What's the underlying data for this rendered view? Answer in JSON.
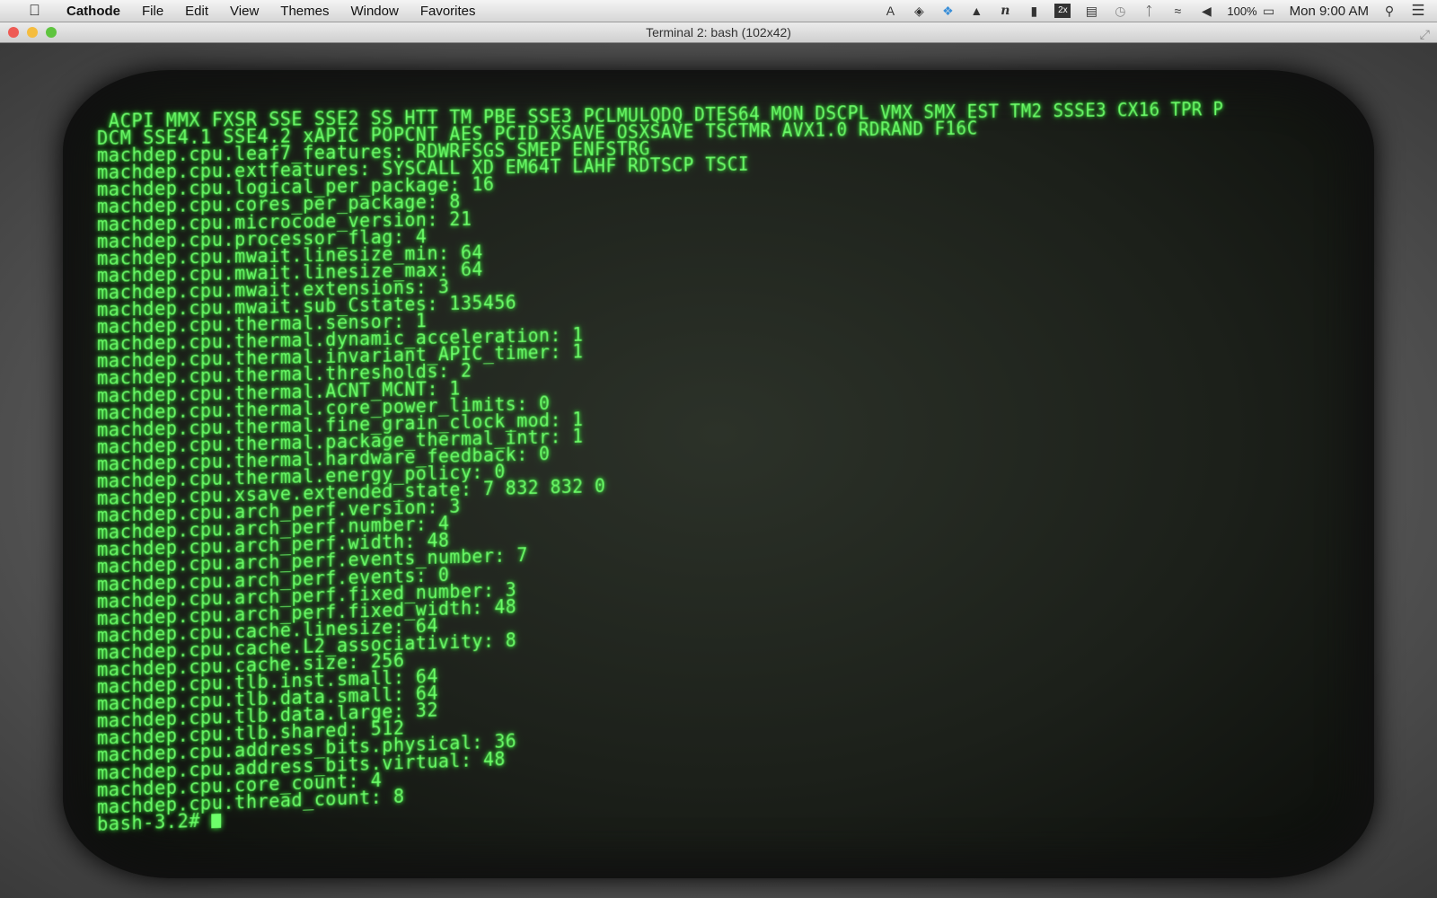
{
  "menubar": {
    "app": "Cathode",
    "items": [
      "File",
      "Edit",
      "View",
      "Themes",
      "Window",
      "Favorites"
    ],
    "status_icons": [
      "adobe-icon",
      "layers-icon",
      "dropbox-icon",
      "google-drive-icon",
      "n-icon",
      "istat-icon",
      "display-2x-icon",
      "memory-icon",
      "time-machine-icon",
      "bluetooth-icon",
      "wifi-icon",
      "volume-icon"
    ],
    "battery": "100%",
    "clock": "Mon 9:00 AM"
  },
  "window": {
    "title": "Terminal 2: bash (102x42)"
  },
  "terminal": {
    "lines": [
      " ACPI MMX FXSR SSE SSE2 SS HTT TM PBE SSE3 PCLMULQDQ DTES64 MON DSCPL VMX SMX EST TM2 SSSE3 CX16 TPR P",
      "DCM SSE4.1 SSE4.2 xAPIC POPCNT AES PCID XSAVE OSXSAVE TSCTMR AVX1.0 RDRAND F16C",
      "machdep.cpu.leaf7_features: RDWRFSGS SMEP ENFSTRG",
      "machdep.cpu.extfeatures: SYSCALL XD EM64T LAHF RDTSCP TSCI",
      "machdep.cpu.logical_per_package: 16",
      "machdep.cpu.cores_per_package: 8",
      "machdep.cpu.microcode_version: 21",
      "machdep.cpu.processor_flag: 4",
      "machdep.cpu.mwait.linesize_min: 64",
      "machdep.cpu.mwait.linesize_max: 64",
      "machdep.cpu.mwait.extensions: 3",
      "machdep.cpu.mwait.sub_Cstates: 135456",
      "machdep.cpu.thermal.sensor: 1",
      "machdep.cpu.thermal.dynamic_acceleration: 1",
      "machdep.cpu.thermal.invariant_APIC_timer: 1",
      "machdep.cpu.thermal.thresholds: 2",
      "machdep.cpu.thermal.ACNT_MCNT: 1",
      "machdep.cpu.thermal.core_power_limits: 0",
      "machdep.cpu.thermal.fine_grain_clock_mod: 1",
      "machdep.cpu.thermal.package_thermal_intr: 1",
      "machdep.cpu.thermal.hardware_feedback: 0",
      "machdep.cpu.thermal.energy_policy: 0",
      "machdep.cpu.xsave.extended_state: 7 832 832 0",
      "machdep.cpu.arch_perf.version: 3",
      "machdep.cpu.arch_perf.number: 4",
      "machdep.cpu.arch_perf.width: 48",
      "machdep.cpu.arch_perf.events_number: 7",
      "machdep.cpu.arch_perf.events: 0",
      "machdep.cpu.arch_perf.fixed_number: 3",
      "machdep.cpu.arch_perf.fixed_width: 48",
      "machdep.cpu.cache.linesize: 64",
      "machdep.cpu.cache.L2_associativity: 8",
      "machdep.cpu.cache.size: 256",
      "machdep.cpu.tlb.inst.small: 64",
      "machdep.cpu.tlb.data.small: 64",
      "machdep.cpu.tlb.data.large: 32",
      "machdep.cpu.tlb.shared: 512",
      "machdep.cpu.address_bits.physical: 36",
      "machdep.cpu.address_bits.virtual: 48",
      "machdep.cpu.core_count: 4",
      "machdep.cpu.thread_count: 8"
    ],
    "prompt": "bash-3.2# "
  },
  "colors": {
    "phosphor": "#6dff6a"
  }
}
